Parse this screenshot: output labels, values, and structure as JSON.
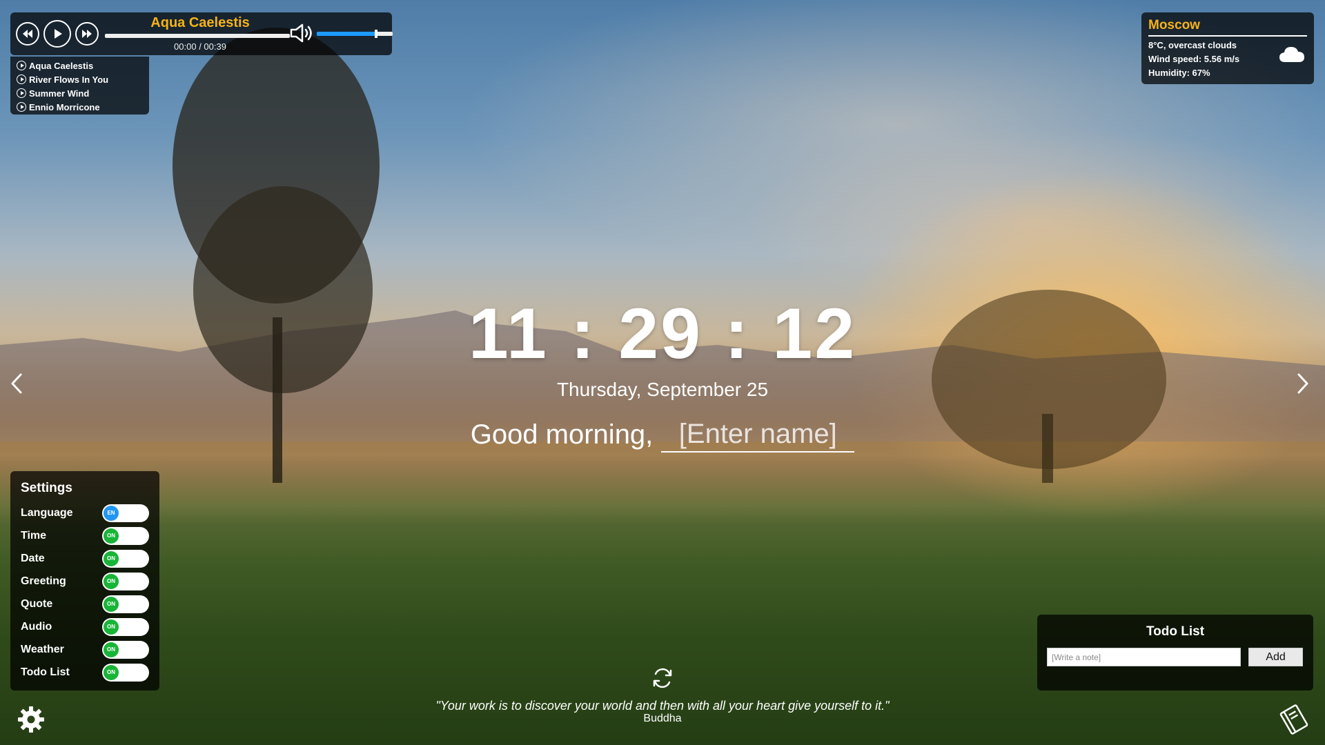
{
  "player": {
    "track_title": "Aqua Caelestis",
    "time": "00:00 / 00:39",
    "volume_level": 0.78,
    "progress_level": 0,
    "controls": [
      "rewind-icon",
      "play-icon",
      "fast-forward-icon"
    ],
    "volume_icon": "speaker-icon",
    "accent_color": "#f6b318"
  },
  "playlist": {
    "items": [
      {
        "label": "Aqua Caelestis"
      },
      {
        "label": "River Flows In You"
      },
      {
        "label": "Summer Wind"
      },
      {
        "label": "Ennio Morricone"
      }
    ]
  },
  "weather": {
    "city": "Moscow",
    "description": "8°C, overcast clouds",
    "wind": "Wind speed: 5.56 m/s",
    "humidity": "Humidity: 67%",
    "icon": "cloud-icon"
  },
  "clock": {
    "time": "11:29:12",
    "date": "Thursday, September 25"
  },
  "greeting": {
    "text": "Good morning,",
    "name_placeholder": "[Enter name]"
  },
  "settings": {
    "title": "Settings",
    "items": [
      {
        "label": "Language",
        "toggle": "EN",
        "state_color": "#2196f3"
      },
      {
        "label": "Time",
        "toggle": "ON",
        "state_color": "#18b437"
      },
      {
        "label": "Date",
        "toggle": "ON",
        "state_color": "#18b437"
      },
      {
        "label": "Greeting",
        "toggle": "ON",
        "state_color": "#18b437"
      },
      {
        "label": "Quote",
        "toggle": "ON",
        "state_color": "#18b437"
      },
      {
        "label": "Audio",
        "toggle": "ON",
        "state_color": "#18b437"
      },
      {
        "label": "Weather",
        "toggle": "ON",
        "state_color": "#18b437"
      },
      {
        "label": "Todo List",
        "toggle": "ON",
        "state_color": "#18b437"
      }
    ]
  },
  "quote": {
    "text": "\"Your work is to discover your world and then with all your heart give yourself to it.\"",
    "author": "Buddha"
  },
  "todo": {
    "title": "Todo List",
    "placeholder": "[Write a note]",
    "add_label": "Add"
  }
}
